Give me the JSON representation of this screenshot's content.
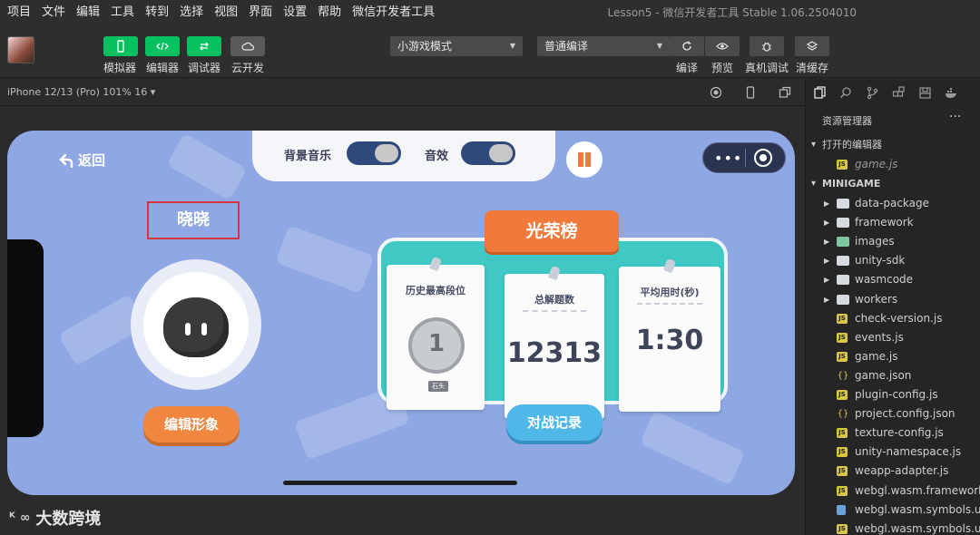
{
  "menu": [
    "项目",
    "文件",
    "编辑",
    "工具",
    "转到",
    "选择",
    "视图",
    "界面",
    "设置",
    "帮助",
    "微信开发者工具"
  ],
  "window_title": "Lesson5 - 微信开发者工具 Stable 1.06.2504010",
  "toolbar": {
    "left_buttons": [
      {
        "label": "模拟器",
        "icon": "phone-icon"
      },
      {
        "label": "编辑器",
        "icon": "code-icon"
      },
      {
        "label": "调试器",
        "icon": "debug-icon"
      },
      {
        "label": "云开发",
        "icon": "cloud-icon"
      }
    ],
    "mode_select": "小游戏模式",
    "compile_select": "普通编译",
    "right_buttons": [
      {
        "label": "编译",
        "icon": "refresh-icon"
      },
      {
        "label": "预览",
        "icon": "eye-icon"
      },
      {
        "label": "真机调试",
        "icon": "bug-icon"
      },
      {
        "label": "清缓存",
        "icon": "layers-icon"
      }
    ]
  },
  "device_label": "iPhone 12/13 (Pro) 101% 16 ▾",
  "game": {
    "back_label": "返回",
    "bgm_label": "背景音乐",
    "sfx_label": "音效",
    "player_name": "晓晓",
    "edit_button": "编辑形象",
    "board_title": "光荣榜",
    "cards": [
      {
        "title": "历史最高段位",
        "rank": "1",
        "rank_tag": "石头"
      },
      {
        "title": "总解题数",
        "value": "12313"
      },
      {
        "title": "平均用时(秒)",
        "value": "1:30"
      }
    ],
    "record_button": "对战记录"
  },
  "watermark": "大数跨境",
  "explorer": {
    "title": "资源管理器",
    "open_editors_label": "打开的编辑器",
    "open_file": "game.js",
    "project_label": "MINIGAME",
    "items": [
      {
        "name": "data-package",
        "type": "folder"
      },
      {
        "name": "framework",
        "type": "folder"
      },
      {
        "name": "images",
        "type": "folder-green"
      },
      {
        "name": "unity-sdk",
        "type": "folder"
      },
      {
        "name": "wasmcode",
        "type": "folder"
      },
      {
        "name": "workers",
        "type": "folder"
      },
      {
        "name": "check-version.js",
        "type": "js"
      },
      {
        "name": "events.js",
        "type": "js"
      },
      {
        "name": "game.js",
        "type": "js"
      },
      {
        "name": "game.json",
        "type": "json"
      },
      {
        "name": "plugin-config.js",
        "type": "js"
      },
      {
        "name": "project.config.json",
        "type": "json"
      },
      {
        "name": "texture-config.js",
        "type": "js"
      },
      {
        "name": "unity-namespace.js",
        "type": "js"
      },
      {
        "name": "weapp-adapter.js",
        "type": "js"
      },
      {
        "name": "webgl.wasm.framework...",
        "type": "js"
      },
      {
        "name": "webgl.wasm.symbols.u...",
        "type": "file"
      },
      {
        "name": "webgl.wasm.symbols.u...",
        "type": "js"
      }
    ]
  },
  "colors": {
    "accent_green": "#07c160",
    "sim_bg": "#8fa8e3",
    "board_teal": "#3fc8c4",
    "ribbon_orange": "#ef7a3c"
  }
}
